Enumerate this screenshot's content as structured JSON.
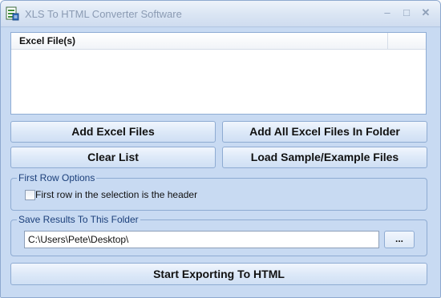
{
  "window": {
    "title": "XLS To HTML Converter Software",
    "minimize_glyph": "–",
    "maximize_glyph": "□",
    "close_glyph": "✕"
  },
  "file_list": {
    "column_header": "Excel File(s)",
    "rows": []
  },
  "buttons": {
    "add_files": "Add Excel Files",
    "add_folder": "Add All Excel Files In Folder",
    "clear_list": "Clear List",
    "load_sample": "Load Sample/Example Files",
    "browse": "...",
    "start_export": "Start Exporting To HTML"
  },
  "first_row_options": {
    "legend": "First Row Options",
    "checkbox_label": "First row in the selection is the header",
    "checked": false
  },
  "save_results": {
    "legend": "Save Results To This Folder",
    "path_value": "C:\\Users\\Pete\\Desktop\\"
  },
  "icons": {
    "app": "excel-converter-app-icon"
  }
}
